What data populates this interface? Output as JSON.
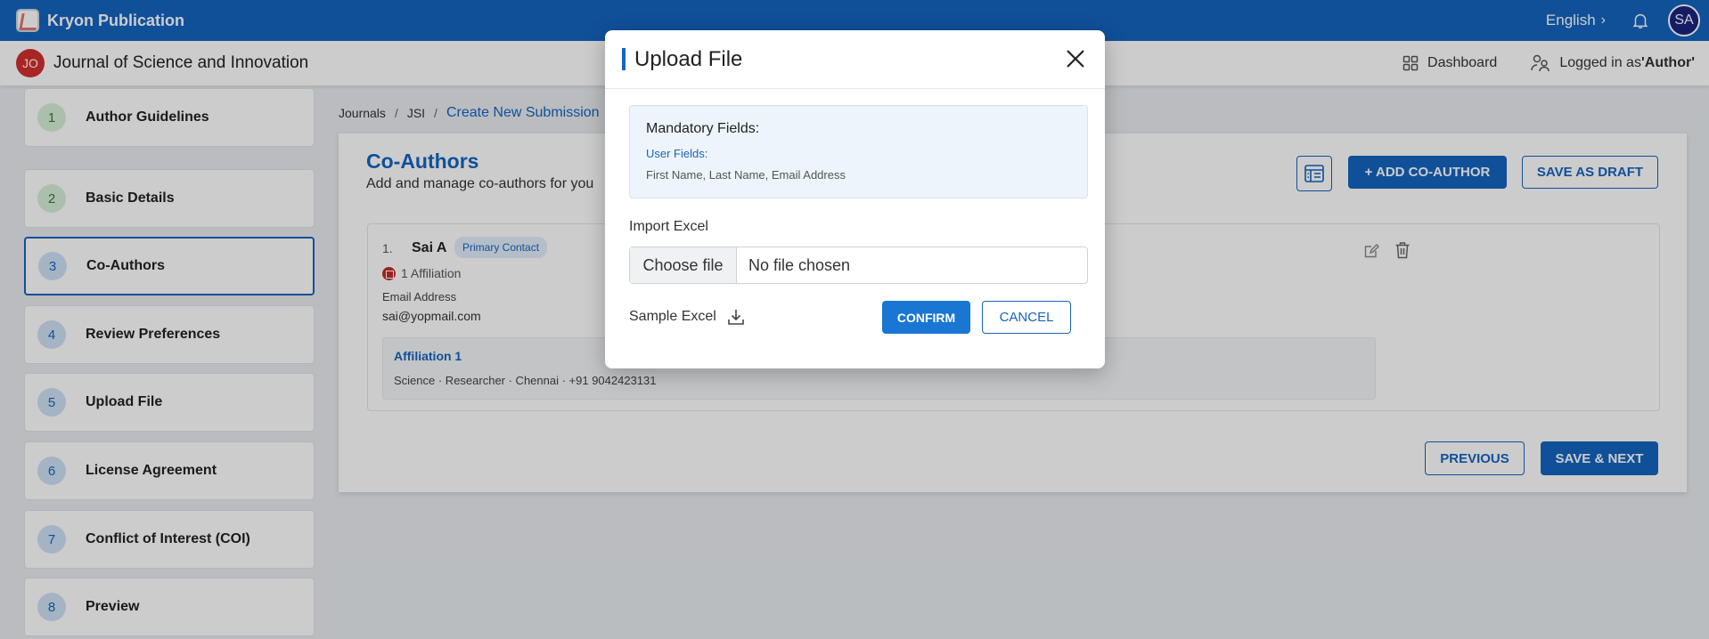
{
  "app": {
    "name": "Kryon Publication",
    "language": "English",
    "user_initials": "SA"
  },
  "journal": {
    "initials": "JO",
    "title": "Journal of Science and Innovation",
    "dashboard_label": "Dashboard",
    "logged_prefix": "Logged in as ",
    "logged_role": "'Author'"
  },
  "steps": [
    {
      "num": "1",
      "label": "Author Guidelines"
    },
    {
      "num": "2",
      "label": "Basic Details"
    },
    {
      "num": "3",
      "label": "Co-Authors"
    },
    {
      "num": "4",
      "label": "Review Preferences"
    },
    {
      "num": "5",
      "label": "Upload File"
    },
    {
      "num": "6",
      "label": "License Agreement"
    },
    {
      "num": "7",
      "label": "Conflict of Interest (COI)"
    },
    {
      "num": "8",
      "label": "Preview"
    }
  ],
  "breadcrumb": [
    "Journals",
    "JSI",
    "Create New Submission"
  ],
  "main": {
    "title": "Co-Authors",
    "subtitle": "Add and manage co-authors for you",
    "add_button": "+ ADD CO-AUTHOR",
    "draft_button": "SAVE AS DRAFT",
    "previous_button": "PREVIOUS",
    "next_button": "SAVE & NEXT"
  },
  "author": {
    "index": "1.",
    "name": "Sai A",
    "badge": "Primary Contact",
    "affiliation_count": "1 Affiliation",
    "email_label": "Email Address",
    "email": "sai@yopmail.com",
    "affiliation_title": "Affiliation 1",
    "affiliation_details": "Science · Researcher · Chennai · +91 9042423131"
  },
  "modal": {
    "title": "Upload File",
    "mandatory_title": "Mandatory Fields:",
    "user_fields_label": "User Fields:",
    "user_fields": "First Name, Last Name, Email Address",
    "import_label": "Import Excel",
    "choose_file": "Choose file",
    "no_file": "No file chosen",
    "sample_label": "Sample Excel",
    "confirm": "CONFIRM",
    "cancel": "CANCEL"
  }
}
